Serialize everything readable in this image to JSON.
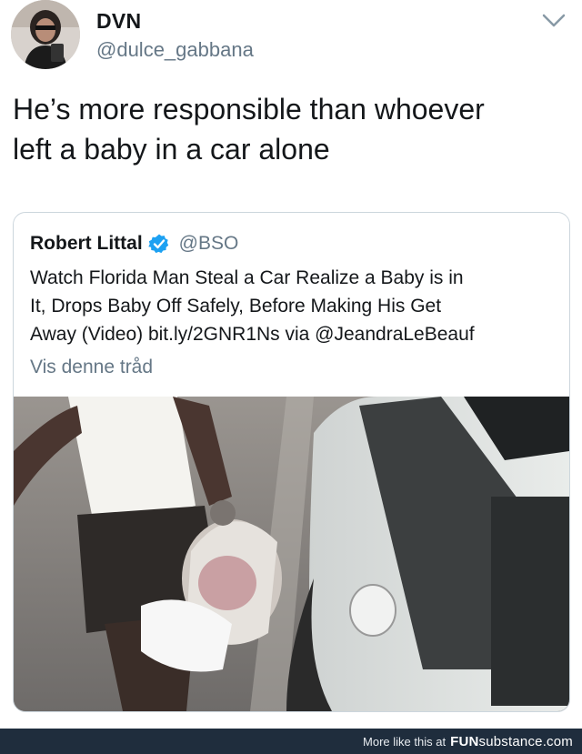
{
  "tweet": {
    "author_name": "DVN",
    "author_handle": "@dulce_gabbana",
    "text_line1": "He’s more responsible than whoever",
    "text_line2": "left a baby in a car alone"
  },
  "quoted_tweet": {
    "author_name": "Robert Littal",
    "author_handle": "@BSO",
    "text_line1": "Watch Florida Man Steal a Car Realize a Baby is in",
    "text_line2": "It, Drops Baby Off Safely, Before Making His Get",
    "text_line3": "Away (Video) bit.ly/2GNR1Ns via @JeandraLeBeauf",
    "show_thread": "Vis denne tråd"
  },
  "footer": {
    "more_text": "More like this at",
    "brand_bold": "FUN",
    "brand_rest": "substance.com"
  },
  "icons": {
    "menu": "chevron-down-icon",
    "verified": "verified-badge-icon"
  },
  "colors": {
    "text": "#14171a",
    "secondary": "#657786",
    "verified": "#1da1f2",
    "footer_bg": "#1f2d3d"
  }
}
